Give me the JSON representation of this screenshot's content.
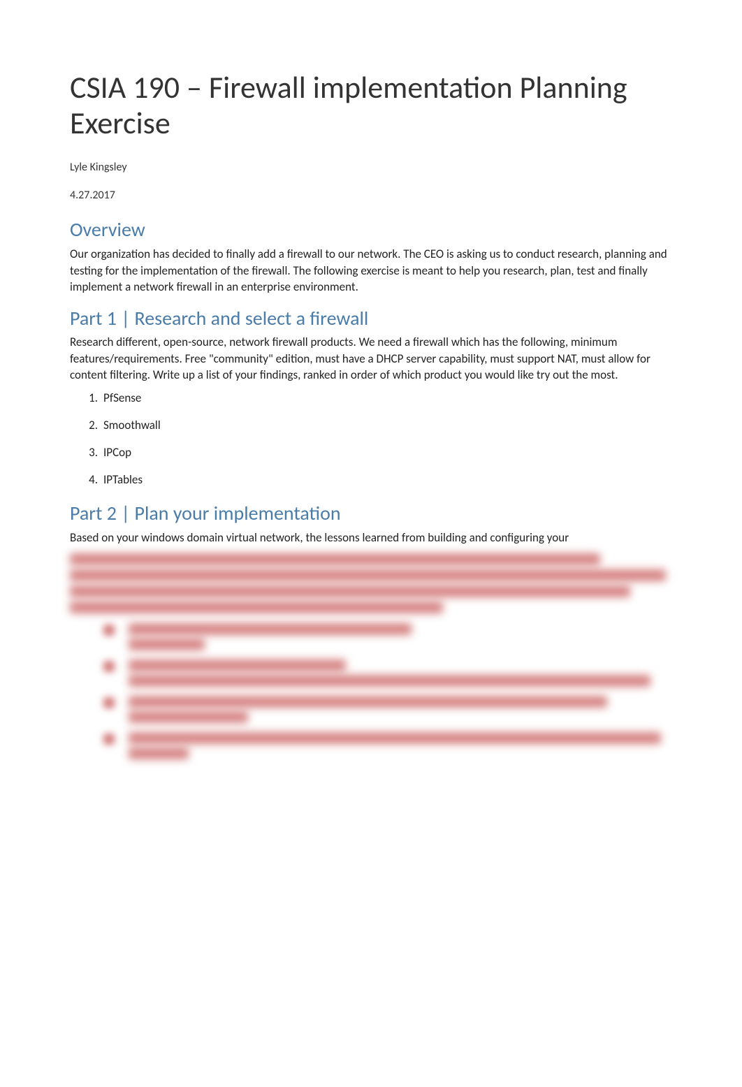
{
  "title": "CSIA 190 – Firewall implementation Planning Exercise",
  "author": "Lyle Kingsley",
  "date": "4.27.2017",
  "sections": {
    "overview": {
      "heading": "Overview",
      "body": "Our organization has decided to finally add a firewall to our network.  The CEO is asking us to conduct research, planning and testing for the implementation of the firewall.  The following exercise is meant to help you research, plan, test and finally implement a network firewall in an enterprise environment."
    },
    "part1": {
      "heading": "Part 1 | Research and select a firewall",
      "body": "Research different, open-source, network firewall products.  We need a firewall which has the following, minimum features/requirements.  Free \"community\" edition, must have a DHCP server capability, must support NAT, must allow for content filtering.  Write up a list of your findings, ranked in order of which product you would like try out the most.",
      "list": [
        "PfSense",
        "Smoothwall",
        "IPCop",
        "IPTables"
      ]
    },
    "part2": {
      "heading": "Part 2 | Plan your implementation",
      "body_visible": "Based on your windows domain virtual network, the lessons learned from building and configuring your"
    }
  }
}
